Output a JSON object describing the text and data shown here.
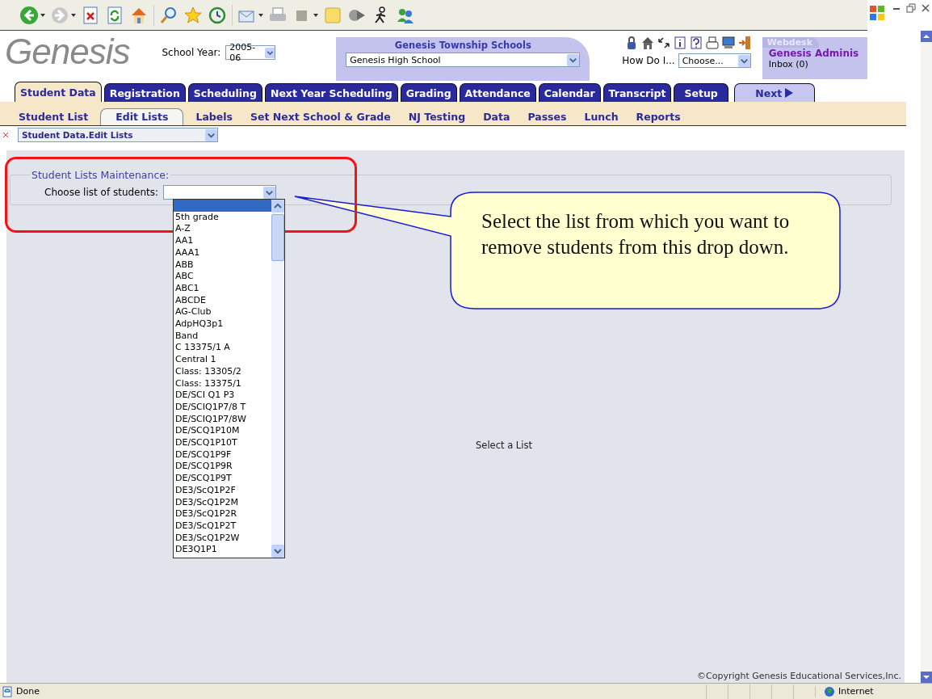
{
  "header": {
    "logo": "Genesis",
    "school_year_label": "School Year:",
    "school_year": "2005-06",
    "district": "Genesis Township Schools",
    "school": "Genesis High School",
    "how_do_i_label": "How Do I...",
    "how_do_i": "Choose...",
    "webdesk": {
      "title": "Webdesk",
      "user": "Genesis Adminis",
      "inbox": "Inbox (0)"
    }
  },
  "tabs": [
    {
      "label": "Student Data",
      "kind": "tab",
      "selected": true
    },
    {
      "label": "Registration",
      "kind": "tab",
      "selected": false
    },
    {
      "label": "Scheduling",
      "kind": "tab",
      "selected": false
    },
    {
      "label": "Next Year Scheduling",
      "kind": "tab",
      "selected": false
    },
    {
      "label": "Grading",
      "kind": "tab",
      "selected": false
    },
    {
      "label": "Attendance",
      "kind": "tab",
      "selected": false
    },
    {
      "label": "Calendar",
      "kind": "tab",
      "selected": false
    },
    {
      "label": "Transcript",
      "kind": "tab",
      "selected": false
    },
    {
      "label": "Setup",
      "kind": "tab",
      "selected": false
    },
    {
      "label": "Next",
      "kind": "next",
      "selected": false
    }
  ],
  "subtabs": [
    {
      "label": "Student List",
      "selected": false
    },
    {
      "label": "Edit Lists",
      "selected": true
    },
    {
      "label": "Labels",
      "selected": false
    },
    {
      "label": "Set Next School & Grade",
      "selected": false
    },
    {
      "label": "NJ Testing",
      "selected": false
    },
    {
      "label": "Data",
      "selected": false
    },
    {
      "label": "Passes",
      "selected": false
    },
    {
      "label": "Lunch",
      "selected": false
    },
    {
      "label": "Reports",
      "selected": false
    }
  ],
  "breadcrumb": "Student Data.Edit Lists",
  "fieldset": {
    "legend": "Student Lists Maintenance:",
    "label": "Choose list of students:"
  },
  "list_dropdown": {
    "blank_highlighted": true,
    "options": [
      "5th grade",
      "A-Z",
      "AA1",
      "AAA1",
      "ABB",
      "ABC",
      "ABC1",
      "ABCDE",
      "AG-Club",
      "AdpHQ3p1",
      "Band",
      "C 13375/1 A",
      "Central 1",
      "Class: 13305/2",
      "Class: 13375/1",
      "DE/SCI Q1 P3",
      "DE/SCIQ1P7/8 T",
      "DE/SCIQ1P7/8W",
      "DE/SCQ1P10M",
      "DE/SCQ1P10T",
      "DE/SCQ1P9F",
      "DE/SCQ1P9R",
      "DE/SCQ1P9T",
      "DE3/ScQ1P2F",
      "DE3/ScQ1P2M",
      "DE3/ScQ1P2R",
      "DE3/ScQ1P2T",
      "DE3/ScQ1P2W",
      "DE3Q1P1"
    ]
  },
  "message": "Select a List",
  "copyright": "©Copyright Genesis Educational Services,Inc.",
  "callout": {
    "text": "Select the list from which you want to remove students from this drop down."
  },
  "status_bar": {
    "text": "Done",
    "zone": "Internet"
  }
}
